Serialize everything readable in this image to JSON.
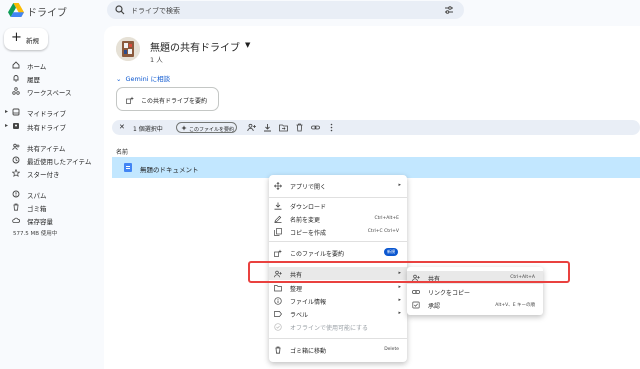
{
  "app": {
    "title": "ドライブ",
    "logo_icon": "google-drive-logo"
  },
  "search": {
    "placeholder": "ドライブで検索"
  },
  "sidebar": {
    "new_label": "新規",
    "items": [
      {
        "label": "ホーム",
        "icon": "home-icon"
      },
      {
        "label": "履歴",
        "icon": "bell-icon"
      },
      {
        "label": "ワークスペース",
        "icon": "workspace-icon"
      },
      {
        "label": "マイドライブ",
        "icon": "my-drive-icon"
      },
      {
        "label": "共有ドライブ",
        "icon": "shared-drive-icon"
      },
      {
        "label": "共有アイテム",
        "icon": "people-icon"
      },
      {
        "label": "最近使用したアイテム",
        "icon": "clock-icon"
      },
      {
        "label": "スター付き",
        "icon": "star-icon"
      },
      {
        "label": "スパム",
        "icon": "spam-icon"
      },
      {
        "label": "ゴミ箱",
        "icon": "trash-icon"
      },
      {
        "label": "保存容量",
        "icon": "cloud-icon"
      }
    ],
    "storage_used": "577.5 MB 使用中"
  },
  "main": {
    "title": "無題の共有ドライブ",
    "members": "1 人",
    "gemini_label": "Gemini に相談",
    "summary_chip": "この共有ドライブを要約",
    "selection": {
      "count": "1 個選択中",
      "summarize_pill": "このファイルを要約"
    },
    "column_name": "名前",
    "row_name": "無題のドキュメント"
  },
  "context_menu": {
    "items": [
      {
        "label": "アプリで開く",
        "arrow": "▸"
      },
      {
        "label": "ダウンロード"
      },
      {
        "label": "名前を変更",
        "shortcut": "Ctrl+Alt+E"
      },
      {
        "label": "コピーを作成",
        "shortcut": "Ctrl+C Ctrl+V"
      },
      {
        "label": "このファイルを要約",
        "badge": "新規"
      },
      {
        "label": "共有",
        "arrow": "▸"
      },
      {
        "label": "整理",
        "arrow": "▸"
      },
      {
        "label": "ファイル情報",
        "arrow": "▸"
      },
      {
        "label": "ラベル",
        "arrow": "▸"
      },
      {
        "label": "オフラインで使用可能にする"
      },
      {
        "label": "ゴミ箱に移動",
        "shortcut": "Delete"
      }
    ]
  },
  "share_submenu": {
    "items": [
      {
        "label": "共有",
        "shortcut": "Ctrl+Alt+A"
      },
      {
        "label": "リンクをコピー"
      },
      {
        "label": "承認",
        "shortcut": "Alt+V、E キーの順"
      }
    ]
  },
  "colors": {
    "accent": "#0b57d0",
    "selected_row": "#c2e7ff",
    "highlight_box": "#e9413f"
  }
}
